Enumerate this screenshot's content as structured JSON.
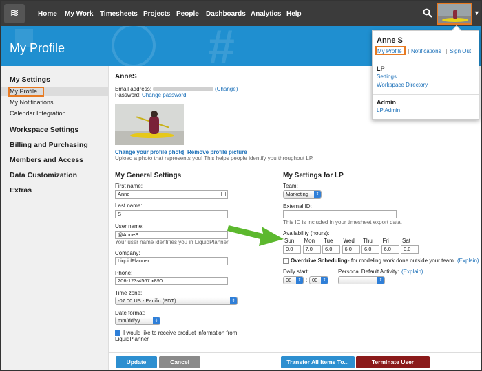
{
  "nav": {
    "logo": "≋",
    "items": [
      "Home",
      "My Work",
      "Timesheets",
      "Projects",
      "People",
      "Dashboards",
      "Analytics",
      "Help"
    ]
  },
  "banner": {
    "title": "My Profile"
  },
  "sidebar": {
    "my_settings": "My Settings",
    "my_profile": "My Profile",
    "my_notifications": "My Notifications",
    "calendar_integration": "Calendar Integration",
    "workspace_settings": "Workspace Settings",
    "billing": "Billing and Purchasing",
    "members": "Members and Access",
    "data_customization": "Data Customization",
    "extras": "Extras"
  },
  "profile": {
    "username_heading": "AnneS",
    "email_label": "Email address:",
    "email_change": "(Change)",
    "password_label": "Password:",
    "password_change": "Change password",
    "change_photo": "Change your profile photo",
    "photo_sep": "|",
    "remove_photo": "Remove profile picture",
    "photo_hint": "Upload a photo that represents you! This helps people identify you throughout LP."
  },
  "general": {
    "heading": "My General Settings",
    "first_name_label": "First name:",
    "first_name": "Anne",
    "last_name_label": "Last name:",
    "last_name": "S",
    "user_name_label": "User name:",
    "user_name": "@AnneS",
    "user_name_hint": "Your user name identifies you in LiquidPlanner.",
    "company_label": "Company:",
    "company": "LiquidPlanner",
    "phone_label": "Phone:",
    "phone": "206-123-4567 x890",
    "timezone_label": "Time zone:",
    "timezone": "-07:00 US - Pacific (PDT)",
    "date_format_label": "Date format:",
    "date_format": "mm/dd/yy",
    "product_info_line1": "I would like to receive product information from",
    "product_info_line2": "LiquidPlanner."
  },
  "lp": {
    "heading": "My Settings for LP",
    "team_label": "Team:",
    "team": "Marketing",
    "external_id_label": "External ID:",
    "external_id": "",
    "external_id_hint": "This ID is included in your timesheet export data.",
    "availability_label": "Availability (hours):",
    "days": [
      "Sun",
      "Mon",
      "Tue",
      "Wed",
      "Thu",
      "Fri",
      "Sat"
    ],
    "hours": [
      "0.0",
      "7.0",
      "6.0",
      "6.0",
      "6.0",
      "6.0",
      "0.0"
    ],
    "overdrive_label": "Overdrive Scheduling",
    "overdrive_desc": "- for modeling work done outside your team.",
    "overdrive_explain": "(Explain)",
    "daily_start_label": "Daily start:",
    "daily_start_hour": "08",
    "daily_start_min": "00",
    "pda_label": "Personal Default Activity:",
    "pda_explain": "(Explain)"
  },
  "buttons": {
    "update": "Update",
    "cancel": "Cancel",
    "transfer": "Transfer All Items To...",
    "terminate": "Terminate User"
  },
  "dropdown": {
    "name": "Anne S",
    "my_profile": "My Profile",
    "notifications": "Notifications",
    "sign_out": "Sign Out",
    "sep": "|",
    "lp_heading": "LP",
    "settings": "Settings",
    "workspace_directory": "Workspace Directory",
    "admin_heading": "Admin",
    "lp_admin": "LP Admin"
  },
  "colors": {
    "topnav": "#3b3b3b",
    "banner": "#1f8fd0",
    "link": "#1a6fb8",
    "highlight": "#e77a22",
    "update_btn": "#2d8fd0",
    "cancel_btn": "#8a8a8a",
    "transfer_btn": "#2d8fd0",
    "terminate_btn": "#8b1a1a",
    "arrow": "#5cb82e"
  }
}
